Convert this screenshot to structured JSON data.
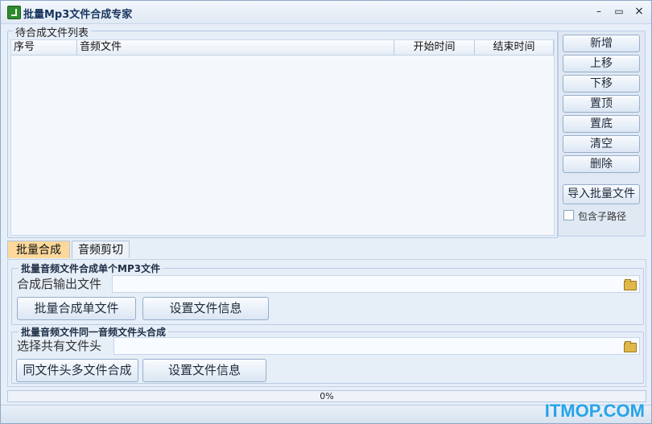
{
  "window": {
    "title": "批量Mp3文件合成专家"
  },
  "file_list": {
    "legend": "待合成文件列表",
    "columns": [
      "序号",
      "音频文件",
      "开始时间",
      "结束时间"
    ],
    "rows": []
  },
  "side_buttons": {
    "add": "新增",
    "move_up": "上移",
    "move_down": "下移",
    "top": "置顶",
    "bottom": "置底",
    "clear": "清空",
    "delete": "删除",
    "import_batch": "导入批量文件",
    "include_subpath": "包含子路径"
  },
  "tabs": [
    {
      "label": "批量合成",
      "active": true
    },
    {
      "label": "音频剪切",
      "active": false
    }
  ],
  "merge_single": {
    "legend": "批量音频文件合成单个MP3文件",
    "output_label": "合成后输出文件",
    "output_value": "",
    "merge_button": "批量合成单文件",
    "info_button": "设置文件信息"
  },
  "merge_header": {
    "legend": "批量音频文件同一音频文件头合成",
    "header_label": "选择共有文件头",
    "header_value": "",
    "merge_button": "同文件头多文件合成",
    "info_button": "设置文件信息"
  },
  "progress": {
    "text": "0%",
    "value": 0
  },
  "watermark": "ITMOP.COM",
  "colors": {
    "active_tab": "#fcd99b",
    "accent": "#27a4e8"
  }
}
